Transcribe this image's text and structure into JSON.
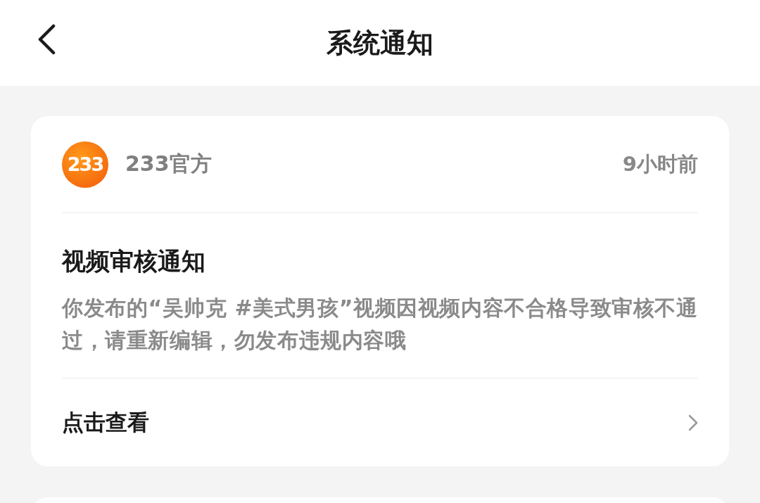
{
  "header": {
    "title": "系统通知"
  },
  "notifications": [
    {
      "avatar_text": "233",
      "sender": "233官方",
      "time": "9小时前",
      "title": "视频审核通知",
      "body": "你发布的“吴帅克 #美式男孩”视频因视频内容不合格导致审核不通过，请重新编辑，勿发布违规内容哦",
      "action": "点击查看"
    }
  ]
}
